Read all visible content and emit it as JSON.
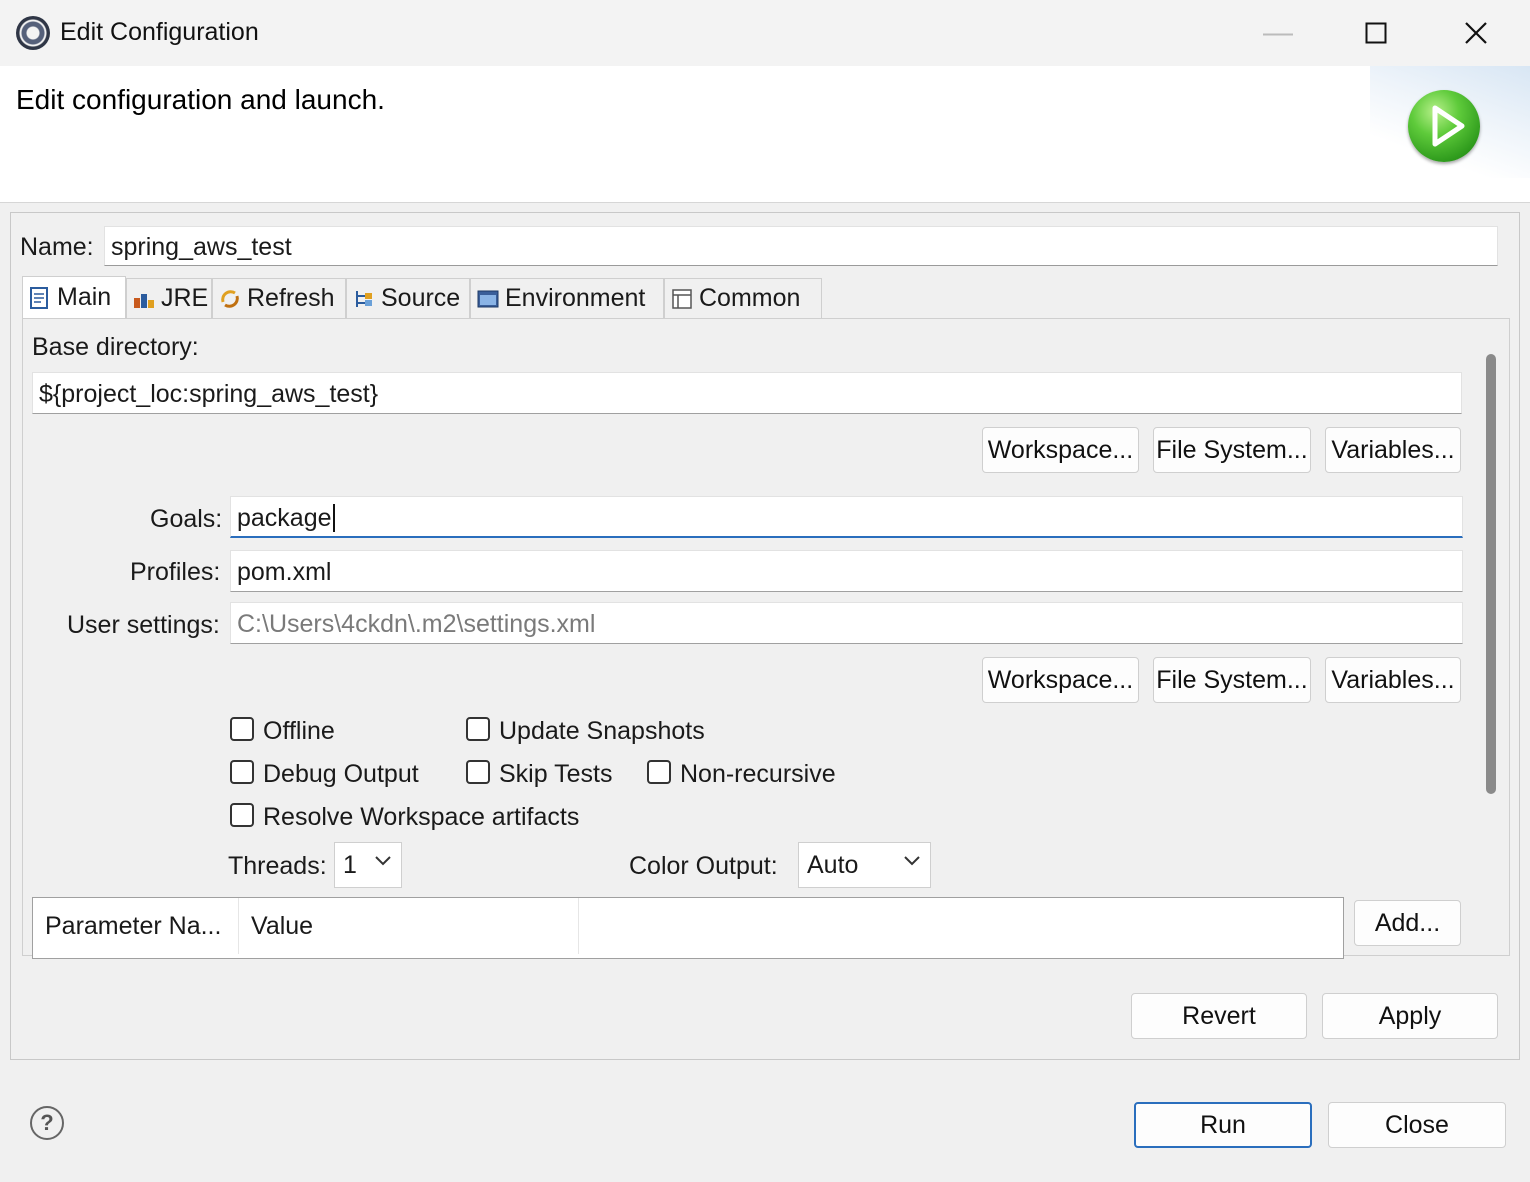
{
  "window": {
    "title": "Edit Configuration",
    "minimize_glyph": "—",
    "maximize_glyph": "☐",
    "close_glyph": "✕"
  },
  "banner": {
    "title": "Edit configuration and launch."
  },
  "name": {
    "label": "Name:",
    "value": "spring_aws_test"
  },
  "tabs": [
    {
      "label": "Main",
      "icon": "main-tab-icon"
    },
    {
      "label": "JRE",
      "icon": "jre-icon"
    },
    {
      "label": "Refresh",
      "icon": "refresh-icon"
    },
    {
      "label": "Source",
      "icon": "source-icon"
    },
    {
      "label": "Environment",
      "icon": "environment-icon"
    },
    {
      "label": "Common",
      "icon": "common-icon"
    }
  ],
  "main": {
    "base_dir_label": "Base directory:",
    "base_dir_value": "${project_loc:spring_aws_test}",
    "workspace_btn": "Workspace...",
    "filesystem_btn": "File System...",
    "variables_btn": "Variables...",
    "goals_label": "Goals:",
    "goals_value": "package",
    "profiles_label": "Profiles:",
    "profiles_value": "pom.xml",
    "user_settings_label": "User settings:",
    "user_settings_placeholder": "C:\\Users\\4ckdn\\.m2\\settings.xml",
    "checkboxes": {
      "offline": "Offline",
      "update_snapshots": "Update Snapshots",
      "debug_output": "Debug Output",
      "skip_tests": "Skip Tests",
      "non_recursive": "Non-recursive",
      "resolve_workspace": "Resolve Workspace artifacts"
    },
    "threads_label": "Threads:",
    "threads_value": "1",
    "color_output_label": "Color Output:",
    "color_output_value": "Auto",
    "table_headers": [
      "Parameter Na...",
      "Value"
    ],
    "add_btn": "Add..."
  },
  "footer": {
    "revert": "Revert",
    "apply": "Apply",
    "run": "Run",
    "close": "Close",
    "help_glyph": "?"
  }
}
